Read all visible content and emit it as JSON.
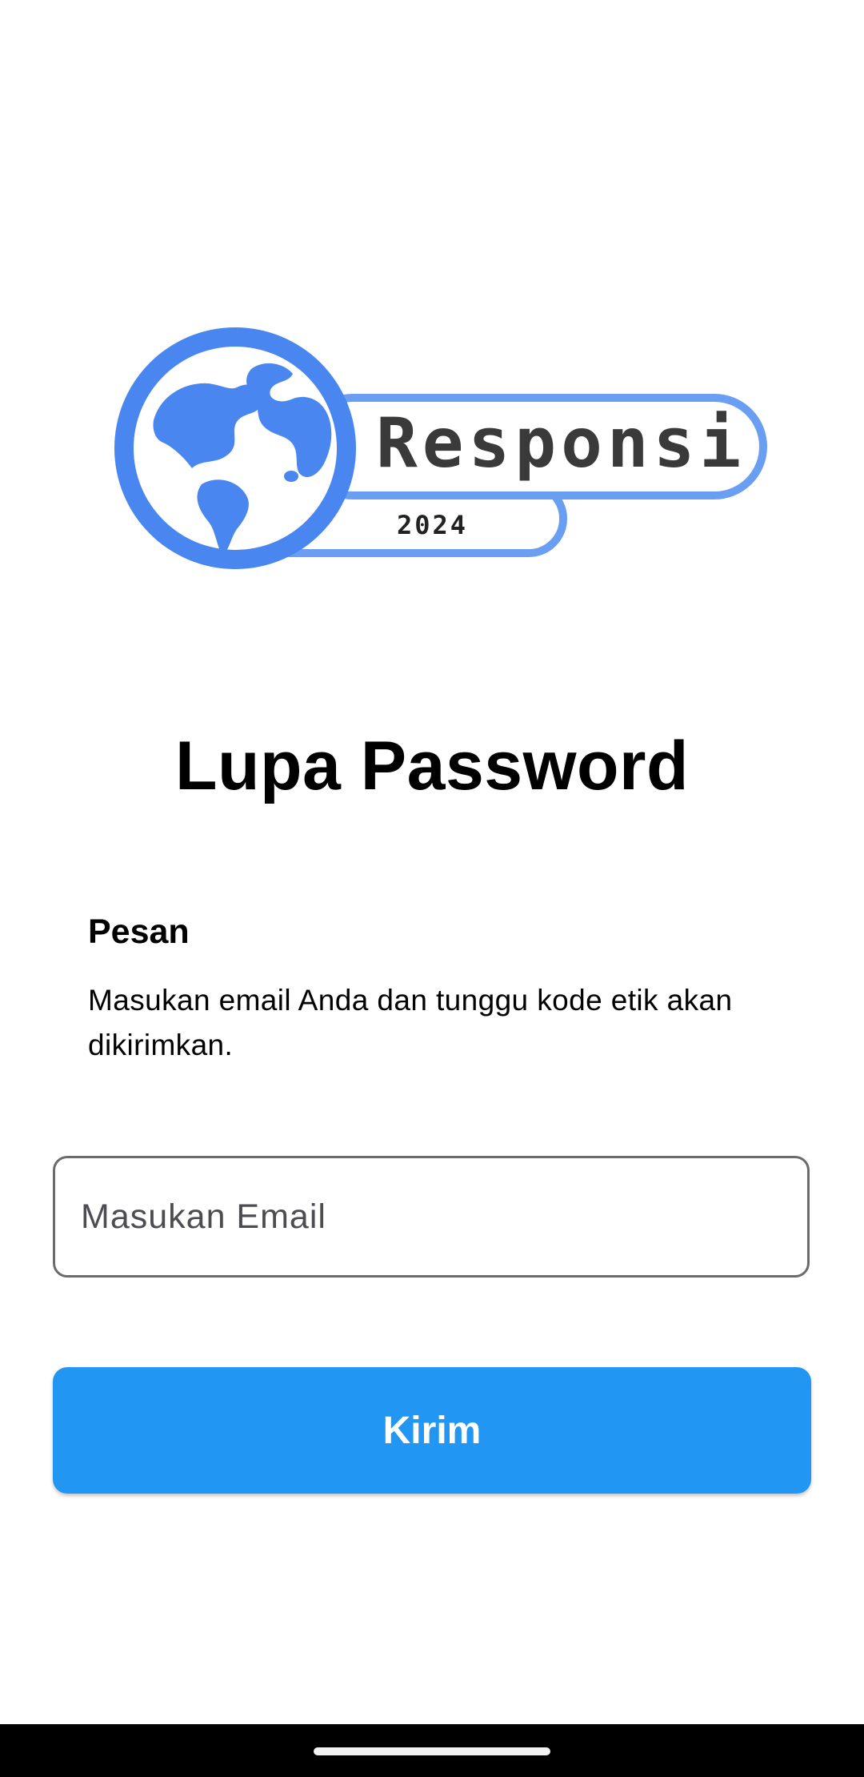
{
  "logo": {
    "brand_text": "Responsi",
    "year_text": "2024",
    "icon": "globe-icon",
    "accent_color": "#4a86f0"
  },
  "page": {
    "title": "Lupa Password"
  },
  "message": {
    "heading": "Pesan",
    "body": "Masukan email Anda dan tunggu kode etik akan dikirimkan."
  },
  "email_input": {
    "placeholder": "Masukan Email",
    "value": ""
  },
  "send_button": {
    "label": "Kirim",
    "color": "#2196f3"
  },
  "system_nav": {
    "indicator": "home-indicator"
  }
}
